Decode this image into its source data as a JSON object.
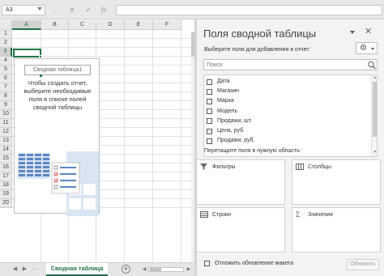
{
  "formula_bar": {
    "name_box": "A3",
    "cancel_icon": "✕",
    "enter_icon": "✓",
    "function_label": "fx",
    "formula_value": ""
  },
  "grid": {
    "columns": [
      "A",
      "B",
      "C",
      "D",
      "E",
      "F"
    ],
    "active_column": "A",
    "rows": [
      "1",
      "2",
      "3",
      "4",
      "5",
      "6",
      "7",
      "8",
      "9",
      "10",
      "11",
      "12",
      "13",
      "14",
      "15",
      "16",
      "17",
      "18",
      "19",
      "20"
    ],
    "active_row": "3",
    "selected_cell": "A3"
  },
  "pivot_placeholder": {
    "name": "Сводная таблица1",
    "message": "Чтобы создать отчет, выберите необходимые поля в списке полей сводной таблицы"
  },
  "sheet_bar": {
    "nav_left": "◀",
    "nav_right": "▶",
    "ellipsis": "...",
    "active_sheet": "Сводная таблица",
    "add_sheet": "+"
  },
  "pane": {
    "title": "Поля сводной таблицы",
    "close_icon": "✕",
    "subtitle": "Выберите поля для добавления в отчет:",
    "search_placeholder": "Поиск",
    "fields": [
      "Дата",
      "Магазин",
      "Марка",
      "Модель",
      "Продажи, шт.",
      "Цена, руб.",
      "Продажи, руб."
    ],
    "drag_label": "Перетащите поля в нужную область:",
    "areas": {
      "filters": "Фильтры",
      "columns": "Столбцы",
      "rows": "Строки",
      "values": "Значения"
    },
    "defer_label": "Отложить обновление макета",
    "update_button": "Обновить",
    "gear_icon": "⚙"
  },
  "colors": {
    "accent": "#217346",
    "illustration_blue": "#5b87c5",
    "illustration_light": "#d9e5f3",
    "checkbox_red": "#d9534f"
  }
}
